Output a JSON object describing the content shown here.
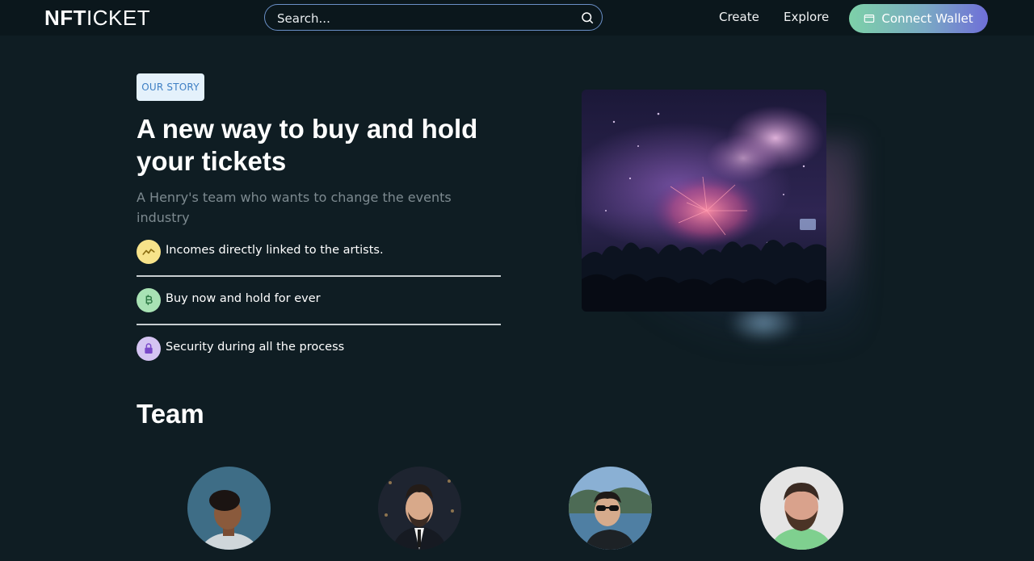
{
  "nav": {
    "logo_bold": "NFT",
    "logo_light": "ICKET",
    "search_placeholder": "Search...",
    "links": [
      "Create",
      "Explore"
    ],
    "connect_wallet": "Connect Wallet"
  },
  "story": {
    "badge": "OUR STORY",
    "headline": "A new way to buy and hold your tickets",
    "subline": "A Henry's team who wants to change the events industry",
    "features": [
      {
        "label": "Incomes directly linked to the artists.",
        "icon": "trend-icon",
        "color": "#f7e38a"
      },
      {
        "label": "Buy now and hold for ever",
        "icon": "bitcoin-icon",
        "color": "#a8e2b4"
      },
      {
        "label": "Security during all the process",
        "icon": "lock-icon",
        "color": "#d4c4f2"
      }
    ]
  },
  "hero": {
    "image": "concert-fireworks-image"
  },
  "team": {
    "title": "Team"
  },
  "colors": {
    "background": "#0f1d23",
    "accent_start": "#7dd1a8",
    "accent_end": "#6f6fd8",
    "badge_text": "#3d7fc4"
  }
}
